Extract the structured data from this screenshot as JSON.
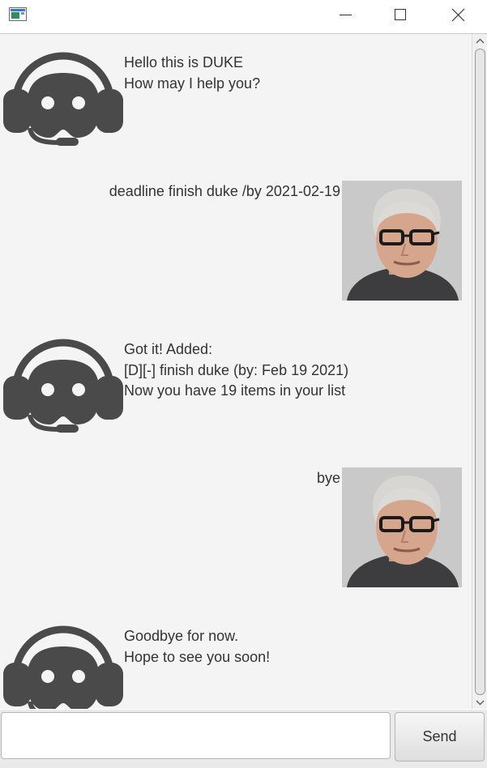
{
  "window": {
    "icon": "window-app-icon",
    "controls": [
      "minimize-icon",
      "maximize-icon",
      "close-icon"
    ]
  },
  "dialog": {
    "messages": [
      {
        "sender": "duke",
        "lines": [
          "Hello this is DUKE",
          "How may I help you?"
        ]
      },
      {
        "sender": "user",
        "lines": [
          "deadline finish duke /by 2021-02-19"
        ]
      },
      {
        "sender": "duke",
        "lines": [
          "Got it! Added:",
          "[D][-] finish duke (by: Feb 19 2021)",
          "Now you have 19 items in your list"
        ]
      },
      {
        "sender": "user",
        "lines": [
          "bye"
        ]
      },
      {
        "sender": "duke",
        "lines": [
          "Goodbye for now.",
          "Hope to see you soon!"
        ]
      }
    ],
    "duke_avatar_icon": "headset-robot-icon",
    "user_avatar": "user-photo"
  },
  "input": {
    "value": "",
    "placeholder": "",
    "send_label": "Send"
  },
  "colors": {
    "dialog_bg": "#f4f4f4",
    "robot": "#4a4a4a",
    "text": "#333333"
  }
}
